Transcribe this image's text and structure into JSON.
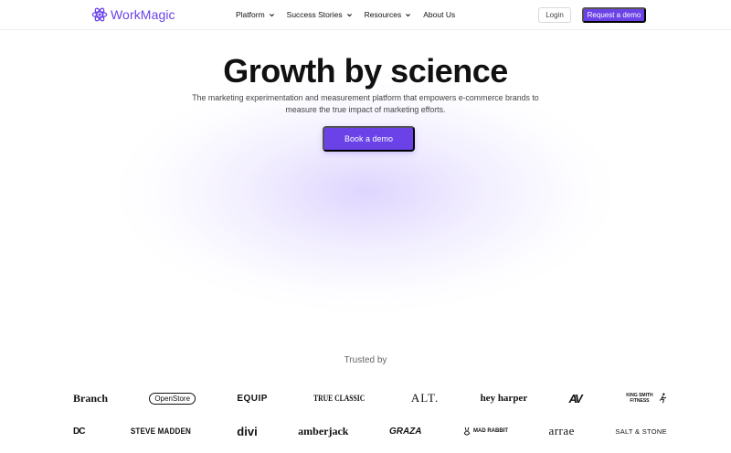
{
  "brand": {
    "name": "WorkMagic",
    "accent_color": "#6a42e8",
    "logo_icon": "atom-icon"
  },
  "nav": {
    "items": [
      {
        "label": "Platform",
        "has_dropdown": true
      },
      {
        "label": "Success Stories",
        "has_dropdown": true
      },
      {
        "label": "Resources",
        "has_dropdown": true
      },
      {
        "label": "About Us",
        "has_dropdown": false
      }
    ],
    "login_label": "Login",
    "request_demo_label": "Request a demo"
  },
  "hero": {
    "title": "Growth by science",
    "subtitle": "The marketing experimentation and measurement platform that empowers e-commerce brands to measure the true impact of marketing efforts.",
    "cta_label": "Book a demo"
  },
  "trusted": {
    "heading": "Trusted by",
    "row1": [
      "Branch",
      "OpenStore",
      "EQUIP",
      "TRUE CLASSIC",
      "ALT.",
      "hey harper",
      "AV",
      "KING SMITH FITNESS"
    ],
    "row2": [
      "DC",
      "STEVE MADDEN",
      "divi",
      "amberjack",
      "GRAZA",
      "MAD RABBIT",
      "arrae",
      "SALT & STONE"
    ]
  }
}
